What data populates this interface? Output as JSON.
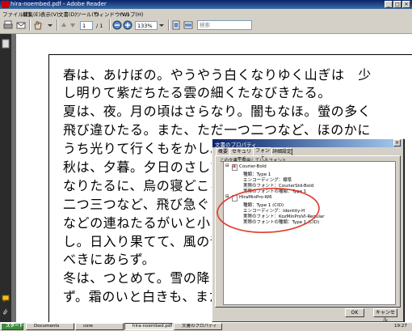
{
  "window": {
    "title": "hira-noembed.pdf - Adobe Reader"
  },
  "menu": [
    "ファイル(F)",
    "編集(E)",
    "表示(V)",
    "文書(D)",
    "ツール(T)",
    "ウィンドウ(W)",
    "ヘルプ(H)"
  ],
  "toolbar": {
    "page_current": "1",
    "page_total": "/ 1",
    "zoom": "133%",
    "search_placeholder": "検索"
  },
  "document": {
    "lines": [
      "春は、あけぼの。やうやう白くなりゆく山ぎは　少",
      "し明りて紫だちたる雲の細くたなびきたる。",
      "夏は、夜。月の頃はさらなり。闇もなほ。螢の多く",
      "飛び違ひたる。また、ただ一つ二つなど、ほのかに",
      "うち光りて行くもをかし。",
      "秋は、夕暮。夕日のさして",
      "なりたるに、烏の寝どころ",
      "二つ三つなど、飛び急ぐさ",
      "などの連ねたるがいと小さ",
      "し。日入り果てて、風の音",
      "べきにあらず。",
      "冬は、つとめて。雪の降り",
      "ず。霜のいと白きも、また"
    ]
  },
  "dialog": {
    "title": "文書のプロパティ",
    "tabs": [
      "概要",
      "セキュリティ",
      "フォント",
      "詳細設定"
    ],
    "active_tab": "フォント",
    "caption": "この文書で使用しているフォント",
    "fonts": [
      {
        "name": "Courier-Bold",
        "details": [
          "種類：Type 1",
          "エンコーディング：標準",
          "実際のフォント：CourierStd-Bold",
          "実際のフォントの種類：Type 1"
        ]
      },
      {
        "name": "HiraMinPro-W6",
        "details": [
          "種類：Type 1 (CID)",
          "エンコーディング：Identity-H",
          "実際のフォント：KozMinProVI-Regular",
          "実際のフォントの種類：Type 1 (CID)"
        ]
      }
    ],
    "ok_label": "OK",
    "cancel_label": "キャンセル"
  },
  "taskbar": {
    "start_label": "スタート",
    "tasks": [
      "Documents",
      "core",
      "hira-noembed.pdf -",
      "文書のプロパティ"
    ],
    "clock": "19:27"
  },
  "colors": {
    "annotation_circle": "#e03a2a",
    "titlebar": "#0a246a"
  }
}
